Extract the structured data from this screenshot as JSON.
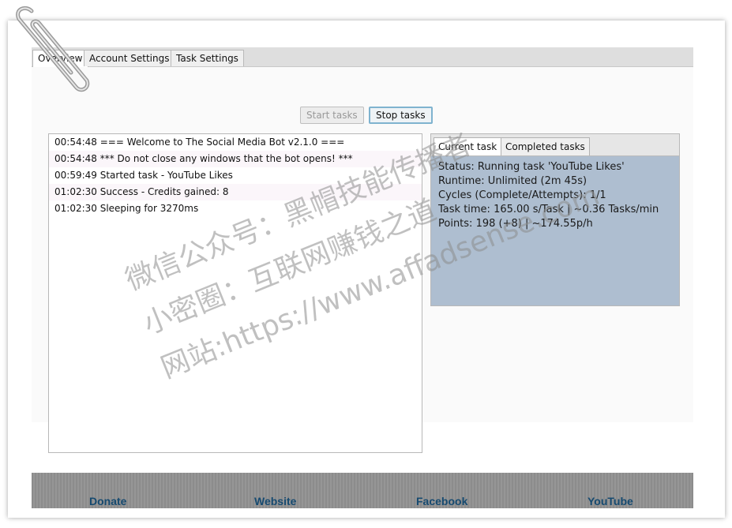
{
  "tabs": [
    "Overview",
    "Account Settings",
    "Task Settings"
  ],
  "buttons": {
    "start": "Start tasks",
    "stop": "Stop tasks"
  },
  "log": [
    "00:54:48 === Welcome to The Social Media Bot v2.1.0 ===",
    "00:54:48 *** Do not close any windows that the bot opens! ***",
    "00:59:49 Started task - YouTube Likes",
    "01:02:30 Success - Credits gained: 8",
    "01:02:30 Sleeping for 3270ms"
  ],
  "panel": {
    "tabs": [
      "Current task",
      "Completed tasks"
    ],
    "status": [
      "Status: Running task 'YouTube Likes'",
      "Runtime: Unlimited (2m 45s)",
      "Cycles (Complete/Attempts): 1/1",
      "Task time: 165.00 s/Task | ~0.36 Tasks/min",
      "Points: 198 (+8) | ~174.55p/h"
    ]
  },
  "footer": [
    "Donate",
    "Website",
    "Facebook",
    "YouTube"
  ],
  "watermark": [
    "微信公众号：黑帽技能传播者",
    "小密圈：互联网赚钱之道",
    "网站:https://www.affadsense.com"
  ]
}
